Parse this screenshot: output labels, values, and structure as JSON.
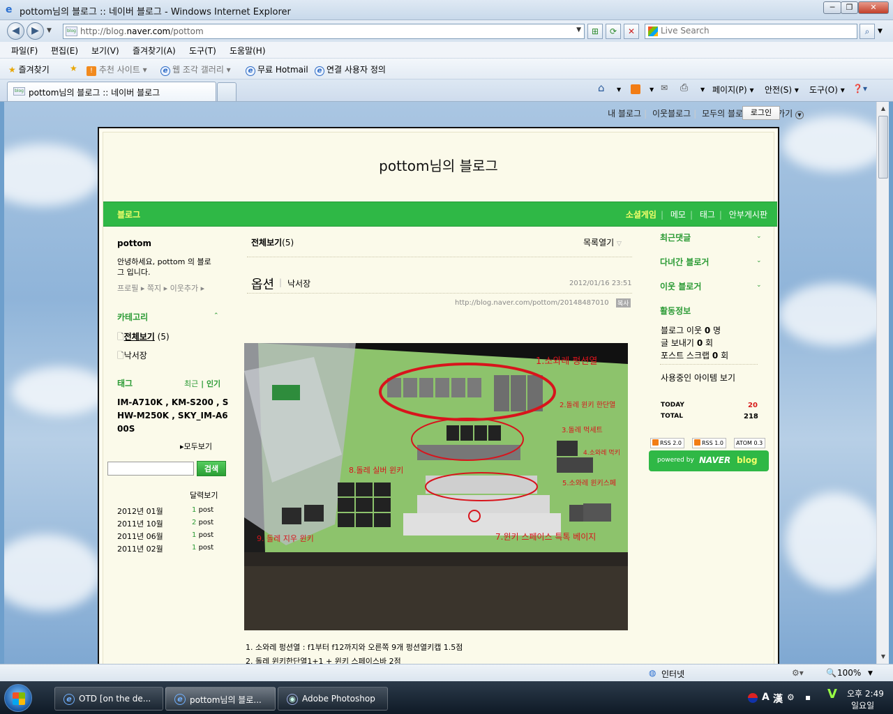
{
  "window": {
    "title": "pottom님의 블로그 :: 네이버 블로그 - Windows Internet Explorer",
    "min": "─",
    "max": "❐",
    "close": "✕"
  },
  "nav": {
    "url_prefix": "http://blog.",
    "url_domain": "naver.com",
    "url_suffix": "/pottom",
    "fav_label": "blog",
    "search_placeholder": "Live Search"
  },
  "menu": [
    "파일(F)",
    "편집(E)",
    "보기(V)",
    "즐겨찾기(A)",
    "도구(T)",
    "도움말(H)"
  ],
  "favbar": {
    "favorites": "즐겨찾기",
    "suggested": "추천 사이트 ▾",
    "webslice": "웹 조각 갤러리 ▾",
    "hotmail": "무료 Hotmail",
    "links": "연결 사용자 정의"
  },
  "tab": {
    "label": "pottom님의 블로그 :: 네이버 블로그"
  },
  "commands": {
    "page": "페이지(P) ▾",
    "safety": "안전(S) ▾",
    "tools": "도구(O) ▾",
    "help": "❓▾"
  },
  "topnav": [
    "내 블로그",
    "이웃블로그",
    "모두의 블로그",
    "바로가기"
  ],
  "login": "로그인",
  "blog": {
    "title": "pottom님의 블로그",
    "name": "블로그",
    "menu": [
      "소셜게임",
      "메모",
      "태그",
      "안부게시판"
    ]
  },
  "profile": {
    "nick": "pottom",
    "intro_1": "안녕하세요, pottom 의 블로",
    "intro_2": "그 입니다.",
    "links": "프로필 ▸ 쪽지 ▸ 이웃추가 ▸"
  },
  "category": {
    "heading": "카테고리",
    "all": "전체보기",
    "all_count": "(5)",
    "sub": "낙서장"
  },
  "tags": {
    "heading": "태그",
    "recent": "최근",
    "popular": "인기",
    "line1": "IM-A710K , KM-S200 , S",
    "line2": "HW-M250K , SKY_IM-A6",
    "line3": "00S",
    "more": "▸모두보기"
  },
  "search": {
    "button": "검색",
    "value": ""
  },
  "calendar": {
    "heading": "달력보기",
    "rows": [
      {
        "month": "2012년 01월",
        "count": "1",
        "unit": "post"
      },
      {
        "month": "2011년 10월",
        "count": "2",
        "unit": "post"
      },
      {
        "month": "2011년 06월",
        "count": "1",
        "unit": "post"
      },
      {
        "month": "2011년 02월",
        "count": "1",
        "unit": "post"
      }
    ]
  },
  "post": {
    "list_title": "전체보기",
    "list_count": "(5)",
    "list_open": "목록열기",
    "title": "옵션",
    "category": "낙서장",
    "date": "2012/01/16 23:51",
    "permalink": "http://blog.naver.com/pottom/20148487010",
    "copy": "복사",
    "body_1": "1. 소와레 펑션열 : f1부터 f12까지와 오른쪽 9개 펑션열키캡  1.5점",
    "body_2": "2. 돌레 윈키한단열1+1 + 윈키 스페이스바  2점"
  },
  "image_annotations": [
    "1.소와레 펑션열",
    "2.돌레 윈키 한단열",
    "3.돌레 먹세트",
    "4.소와레 먹키",
    "5.소와레 윈키스페",
    "7.윈키 스페이스 특톡 베이지",
    "8.돌레 실버 윈키",
    "9. 돌레 지우 윈키"
  ],
  "right": {
    "recent_comments": "최근댓글",
    "visitors": "다녀간 블로거",
    "neighbors": "이웃 블로거",
    "activity": "활동정보",
    "stat1_label": "블로그 이웃",
    "stat1_val": "0",
    "stat1_unit": "명",
    "stat2_label": "글 보내기",
    "stat2_val": "0",
    "stat2_unit": "회",
    "stat3_label": "포스트 스크랩",
    "stat3_val": "0",
    "stat3_unit": "회",
    "items": "사용중인 아이템 보기",
    "today_label": "TODAY",
    "today_val": "20",
    "total_label": "TOTAL",
    "total_val": "218",
    "rss2": "RSS 2.0",
    "rss1": "RSS 1.0",
    "atom": "ATOM 0.3",
    "powered": "powered by",
    "naver": "NAVER",
    "naver_blog": "blog"
  },
  "status": {
    "zone": "인터넷",
    "zoom": "100%"
  },
  "taskbar": {
    "t1": "OTD [on the de...",
    "t2": "pottom님의 블로...",
    "t3": "Adobe Photoshop",
    "ime_a": "A",
    "ime_han": "漢",
    "time": "오후 2:49",
    "day": "일요일"
  },
  "colors": {
    "naver_green": "#2fb846",
    "accent_yellow": "#f4ff6a",
    "today_red": "#d71a1a"
  }
}
